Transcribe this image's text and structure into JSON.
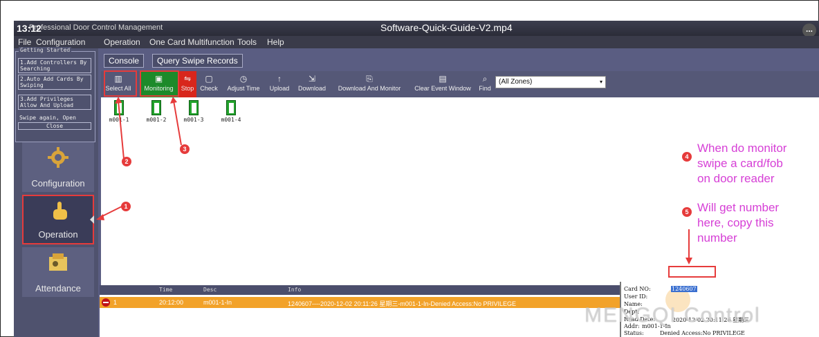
{
  "titlebar": {
    "time": "13:12",
    "app_title": "Professional Door Control Management",
    "video_title": "Software-Quick-Guide-V2.mp4",
    "more": "..."
  },
  "menu": [
    "File",
    "Configuration",
    "Operation",
    "One Card Multifunction",
    "Tools",
    "Help"
  ],
  "getting_started": {
    "title": "Getting Started",
    "steps": [
      "1.Add Controllers By Searching",
      "2.Auto Add Cards By Swiping",
      "3.Add Privileges Allow And Upload"
    ],
    "swipe_text": "Swipe again, Open",
    "close": "Close"
  },
  "nav": {
    "configuration": "Configuration",
    "operation": "Operation",
    "attendance": "Attendance"
  },
  "tabs": {
    "console": "Console",
    "query": "Query Swipe Records"
  },
  "toolbar": {
    "select_all": "Select All",
    "monitoring": "Monitoring",
    "stop": "Stop",
    "check": "Check",
    "adjust_time": "Adjust Time",
    "upload": "Upload",
    "download": "Download",
    "download_monitor": "Download And Monitor",
    "clear_event": "Clear Event Window",
    "find": "Find",
    "zone": "(All Zones)"
  },
  "doors": [
    "m001-1",
    "m001-2",
    "m001-3",
    "m001-4"
  ],
  "events": {
    "headers": {
      "time": "Time",
      "desc": "Desc",
      "info": "Info"
    },
    "row": {
      "index": "1",
      "time": "20:12:00",
      "desc": "m001-1-In",
      "info": "1240607----2020-12-02 20:11:26 星期三-m001-1-In-Denied Access:No PRIVILEGE"
    }
  },
  "details": {
    "card_no_label": "Card NO:",
    "card_no": "1240607",
    "user_id_label": "User ID:",
    "name_label": "Name:",
    "dept_label": "Dept:",
    "read_date_label": "Read Date:",
    "read_date": "2020-12-02 20:11:26 星期三",
    "addr_label": "Addr:",
    "addr": "m001-1-In",
    "status_label": "Status:",
    "status": "Denied Access:No PRIVILEGE"
  },
  "annotations": {
    "n1": "1",
    "n2": "2",
    "n3": "3",
    "n4": "4",
    "n5": "5",
    "note4": [
      "When do monitor",
      "swipe a card/fob",
      "on door reader"
    ],
    "note5": [
      "Will get number",
      "here, copy this",
      "number"
    ]
  },
  "watermark": "MENGQI Control",
  "colors": {
    "accent_red": "#e63b3b",
    "note_magenta": "#d63fd6",
    "event_orange": "#f2a229",
    "monitor_green": "#1d8a2a"
  }
}
